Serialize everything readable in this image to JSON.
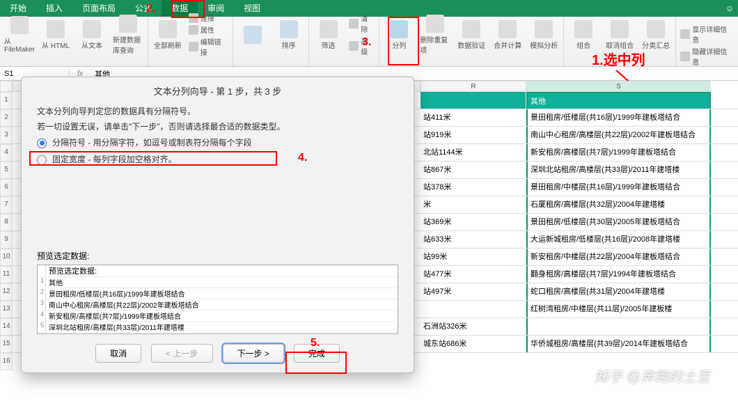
{
  "tabs": [
    "开始",
    "插入",
    "页面布局",
    "公式",
    "数据",
    "审阅",
    "视图"
  ],
  "ribbon": {
    "g1": [
      {
        "label": "从 FileMaker"
      },
      {
        "label": "从 HTML"
      },
      {
        "label": "从文本"
      },
      {
        "label": "新建数据库查询"
      }
    ],
    "g2": {
      "big": "全部刷新",
      "items": [
        "连接",
        "属性",
        "编辑链接"
      ]
    },
    "g3": {
      "sort": [
        "",
        ""
      ],
      "sort_label": "排序"
    },
    "g4": {
      "filter": "筛选",
      "items": [
        "清除",
        "高级"
      ]
    },
    "g5": [
      "分列",
      "删除重复项",
      "数据验证",
      "合并计算",
      "模拟分析"
    ],
    "g6": [
      "组合",
      "取消组合",
      "分类汇总"
    ],
    "g7": [
      "显示详细信息",
      "隐藏详细信息"
    ]
  },
  "formula_bar": {
    "cell": "S1",
    "fx": "fx",
    "val": "其他"
  },
  "cols": {
    "r": "R",
    "s": "S"
  },
  "rows": [
    {
      "r": "",
      "s": "其他"
    },
    {
      "r": "站411米",
      "s": "景田租房/低楼层(共16层)/1999年建板塔结合"
    },
    {
      "r": "站919米",
      "s": "南山中心租房/高楼层(共22层)/2002年建板塔结合"
    },
    {
      "r": "北站1144米",
      "s": "新安租房/高楼层(共7层)/1999年建板塔结合"
    },
    {
      "r": "站867米",
      "s": "深圳北站租房/高楼层(共33层)/2011年建塔楼"
    },
    {
      "r": "站378米",
      "s": "景田租房/中楼层(共16层)/1999年建板塔结合"
    },
    {
      "r": "米",
      "s": "石厦租房/高楼层(共32层)/2004年建塔楼"
    },
    {
      "r": "站369米",
      "s": "景田租房/低楼层(共30层)/2005年建板塔结合"
    },
    {
      "r": "站633米",
      "s": "大运新城租房/低楼层(共16层)/2008年建塔楼"
    },
    {
      "r": "站99米",
      "s": "新安租房/中楼层(共22层)/2004年建板塔结合"
    },
    {
      "r": "站477米",
      "s": "翻身租房/高楼层(共7层)/1994年建板塔结合"
    },
    {
      "r": "站497米",
      "s": "蛇口租房/高楼层(共31层)/2004年建塔楼"
    },
    {
      "r": "",
      "s": "红树湾租房/中楼层(共11层)/2005年建板楼"
    },
    {
      "r": "石洲站326米",
      "s": ""
    },
    {
      "r": "城东站686米",
      "s": "华侨城租房/高楼层(共39层)/2014年建板塔结合"
    }
  ],
  "dialog": {
    "title": "文本分列向导 - 第 1 步，共 3 步",
    "line1": "文本分列向导判定您的数据具有分隔符号。",
    "line2": "若一切设置无误，请单击\"下一步\"，否则请选择最合适的数据类型。",
    "opt1": "分隔符号 - 用分隔字符，如逗号或制表符分隔每个字段",
    "opt2": "固定宽度 - 每列字段加空格对齐。",
    "preview_label": "预览选定数据:",
    "preview_header": "预览选定数据:",
    "preview": [
      "其他",
      "景田租房/低楼层(共16层)/1999年建板塔结合",
      "南山中心租房/高楼层(共22层)/2002年建板塔结合",
      "新安租房/高楼层(共7层)/1999年建板塔结合",
      "深圳北站租房/高楼层(共33层)/2011年建塔楼",
      "景田租房/中楼层(共16层)/1999年建板塔结合"
    ],
    "btn_cancel": "取消",
    "btn_prev": "< 上一步",
    "btn_next": "下一步 >",
    "btn_finish": "完成"
  },
  "ann": {
    "a1": "1.选中列",
    "a2": "2.",
    "a3": "3.",
    "a4": "4.",
    "a5": "5."
  },
  "watermark": "知乎 @奔跑的土豆"
}
